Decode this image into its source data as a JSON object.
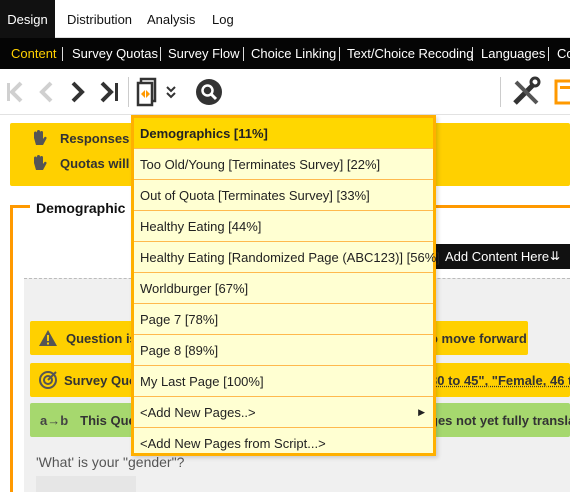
{
  "top_tabs": [
    {
      "label": "Design",
      "active": true
    },
    {
      "label": "Distribution",
      "active": false
    },
    {
      "label": "Analysis",
      "active": false
    },
    {
      "label": "Log",
      "active": false
    }
  ],
  "sub_nav": [
    {
      "label": "Content",
      "active": true
    },
    {
      "label": "Survey Quotas"
    },
    {
      "label": "Survey Flow"
    },
    {
      "label": "Choice Linking"
    },
    {
      "label": "Text/Choice Recoding"
    },
    {
      "label": "Languages"
    },
    {
      "label": "Co"
    }
  ],
  "toolbar": {
    "icons": [
      "first-page-icon",
      "previous-page-icon",
      "next-page-icon",
      "last-page-icon",
      "page-jump-icon",
      "chevron-down-icon",
      "search-icon",
      "tools-icon",
      "export-icon"
    ]
  },
  "warnings": [
    {
      "text": "Responses exi"
    },
    {
      "text": "Quotas will be"
    }
  ],
  "block": {
    "title": "Demographic"
  },
  "add_content": {
    "label": "Add Content Here",
    "icon": "double-chevron-down-icon"
  },
  "notices": [
    {
      "icon": "warning-icon",
      "text": "Question is",
      "tail": "o move forward",
      "color": "#ffd000"
    },
    {
      "icon": "quota-target-icon",
      "text": "Survey Quot",
      "tail": "30 to 45\", \"Female, 46 to",
      "color": "#ffd000"
    },
    {
      "icon": "translate-icon",
      "text": "This Que",
      "tail": "ges not yet fully transla",
      "color": "#a6d86e"
    }
  ],
  "question": {
    "text": "'What' is your \"gender\"?"
  },
  "page_menu": {
    "items": [
      {
        "label": "Demographics [11%]",
        "active": true
      },
      {
        "label": "Too Old/Young [Terminates Survey] [22%]"
      },
      {
        "label": "Out of Quota [Terminates Survey] [33%]"
      },
      {
        "label": "Healthy Eating [44%]"
      },
      {
        "label": "Healthy Eating [Randomized Page (ABC123)] [56%]"
      },
      {
        "label": "Worldburger [67%]"
      },
      {
        "label": "Page 7 [78%]"
      },
      {
        "label": "Page 8 [89%]"
      },
      {
        "label": "My Last Page [100%]"
      },
      {
        "label": "<Add New Pages..>",
        "submenu": true
      },
      {
        "label": "<Add New Pages from Script...>"
      }
    ]
  },
  "colors": {
    "accent_yellow": "#ffd000",
    "block_border": "#ff9900",
    "menu_bg": "#ffffd2",
    "menu_active": "#ffd700",
    "notice_green": "#a6d86e"
  }
}
